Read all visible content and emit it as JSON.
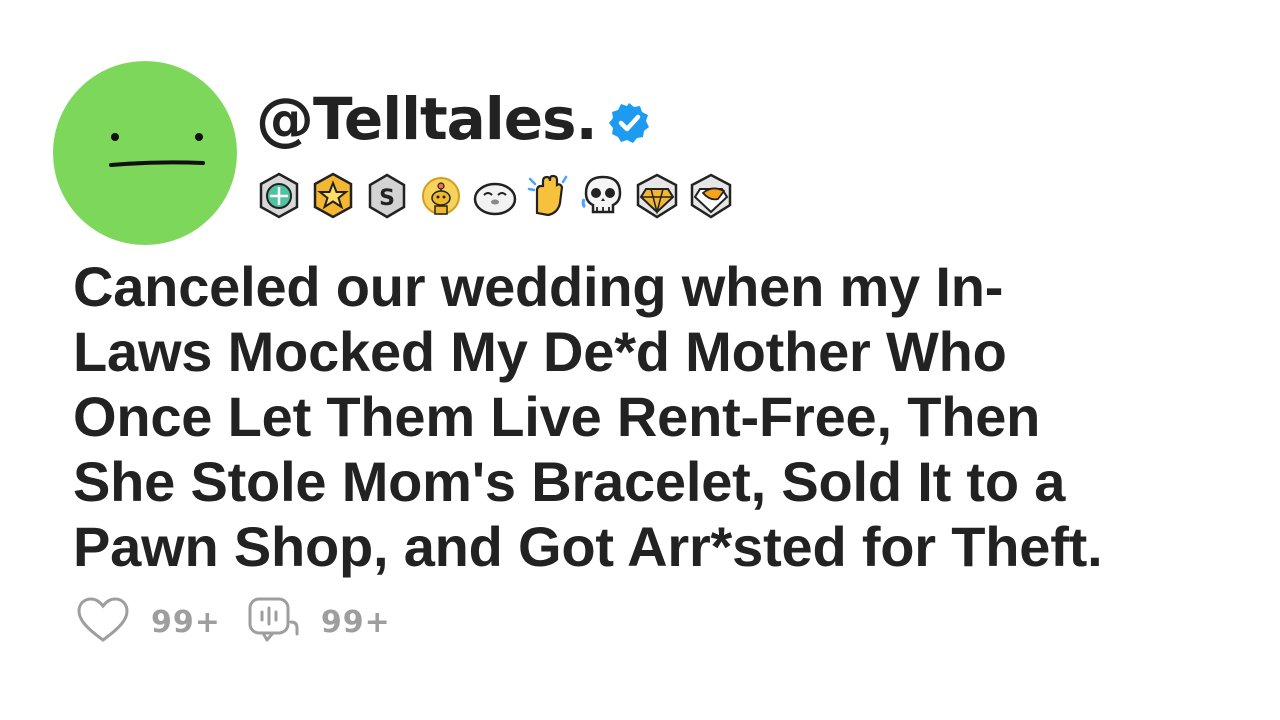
{
  "post": {
    "username": "@Telltales.",
    "verified": true,
    "title_lines": [
      "Canceled our wedding when my In-",
      "Laws Mocked My De*d Mother Who",
      "Once Let Them Live Rent-Free, Then",
      "She Stole Mom's Bracelet, Sold It to a",
      "Pawn Shop, and Got Arr*sted for Theft."
    ],
    "likes": "99+",
    "comments": "99+"
  },
  "badges": [
    "helpful-badge-icon",
    "star-badge-icon",
    "s-badge-icon",
    "reddit-gold-icon",
    "seal-icon",
    "clapping-hands-icon",
    "laughing-skull-icon",
    "gold-gem-badge-icon",
    "duck-gem-badge-icon"
  ],
  "colors": {
    "avatar": "#7dd75a",
    "text": "#222222",
    "verified": "#1d9bf0",
    "muted": "#9e9e9e"
  }
}
